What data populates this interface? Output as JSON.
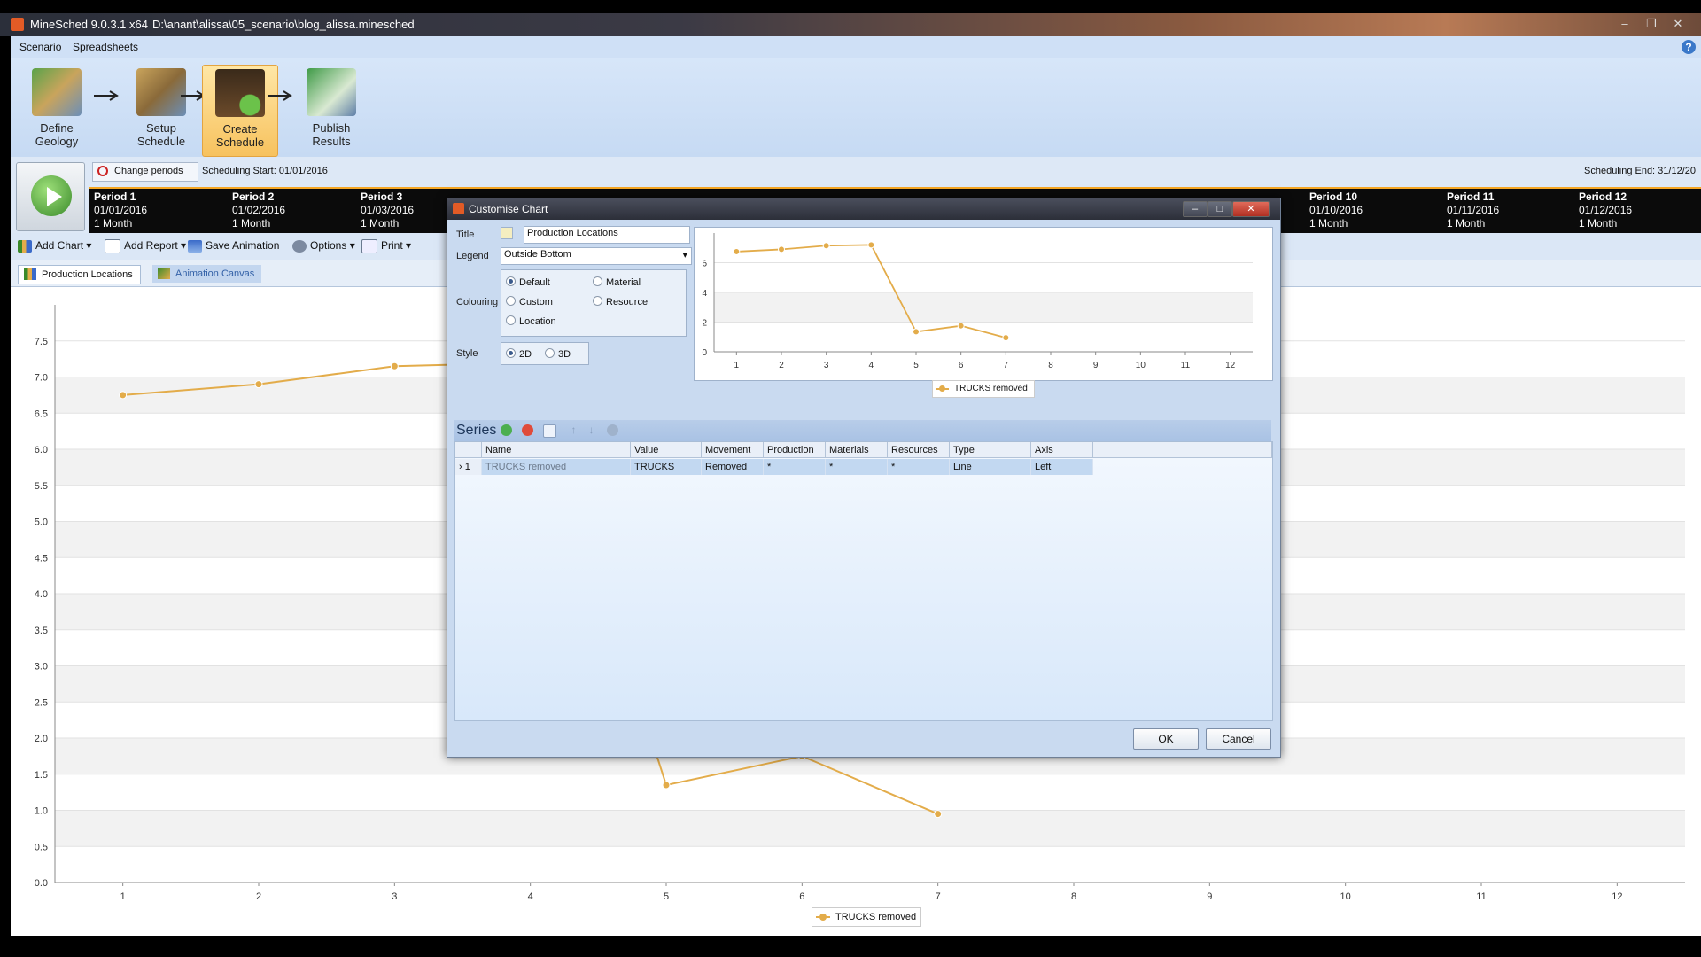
{
  "window": {
    "app_title": "MineSched 9.0.3.1 x64",
    "file_path": "D:\\anant\\alissa\\05_scenario\\blog_alissa.minesched"
  },
  "menu": {
    "items": [
      "Scenario",
      "Spreadsheets"
    ]
  },
  "workflow": {
    "steps": [
      {
        "label": "Define Geology"
      },
      {
        "label": "Setup Schedule"
      },
      {
        "label": "Create Schedule"
      },
      {
        "label": "Publish Results"
      }
    ]
  },
  "periods_bar": {
    "change_periods_label": "Change periods",
    "scheduling_start": "Scheduling Start: 01/01/2016",
    "scheduling_end": "Scheduling End: 31/12/20",
    "periods": [
      {
        "name": "Period 1",
        "date": "01/01/2016",
        "duration": "1 Month"
      },
      {
        "name": "Period 2",
        "date": "01/02/2016",
        "duration": "1 Month"
      },
      {
        "name": "Period 3",
        "date": "01/03/2016",
        "duration": "1 Month"
      },
      {
        "name": "Period 10",
        "date": "01/10/2016",
        "duration": "1 Month"
      },
      {
        "name": "Period 11",
        "date": "01/11/2016",
        "duration": "1 Month"
      },
      {
        "name": "Period 12",
        "date": "01/12/2016",
        "duration": "1 Month"
      }
    ]
  },
  "toolbar": {
    "add_chart": "Add Chart",
    "add_report": "Add Report",
    "save_animation": "Save Animation",
    "options": "Options",
    "print": "Print"
  },
  "tabs": [
    {
      "label": "Production Locations"
    },
    {
      "label": "Animation Canvas"
    }
  ],
  "dialog": {
    "title": "Customise Chart",
    "title_label": "Title",
    "title_value": "Production Locations",
    "legend_label": "Legend",
    "legend_value": "Outside Bottom",
    "colouring_label": "Colouring",
    "colouring_options": [
      "Default",
      "Material",
      "Custom",
      "Resource",
      "Location"
    ],
    "colouring_selected": "Default",
    "style_label": "Style",
    "style_options": [
      "2D",
      "3D"
    ],
    "style_selected": "2D",
    "series_title": "Series",
    "grid_columns": [
      "Name",
      "Value",
      "Movement",
      "Production",
      "Materials",
      "Resources",
      "Type",
      "Axis"
    ],
    "grid_rows": [
      {
        "index": "1",
        "name": "TRUCKS removed",
        "value": "TRUCKS",
        "movement": "Removed",
        "production": "*",
        "materials": "*",
        "resources": "*",
        "type": "Line",
        "axis": "Left"
      }
    ],
    "ok_label": "OK",
    "cancel_label": "Cancel"
  },
  "chart_data": [
    {
      "type": "line",
      "x": [
        1,
        2,
        3,
        4,
        5,
        6,
        7
      ],
      "series": [
        {
          "name": "TRUCKS removed",
          "values": [
            6.75,
            6.9,
            7.15,
            7.2,
            1.35,
            1.75,
            0.95
          ]
        }
      ],
      "x_ticks": [
        1,
        2,
        3,
        4,
        5,
        6,
        7,
        8,
        9,
        10,
        11,
        12
      ],
      "y_ticks": [
        0.0,
        0.5,
        1.0,
        1.5,
        2.0,
        2.5,
        3.0,
        3.5,
        4.0,
        4.5,
        5.0,
        5.5,
        6.0,
        6.5,
        7.0,
        7.5
      ],
      "xlim": [
        0.5,
        12.5
      ],
      "ylim": [
        0,
        8
      ],
      "legend": "bottom",
      "color": "#e3ac4a"
    },
    {
      "type": "line",
      "x": [
        1,
        2,
        3,
        4,
        5,
        6,
        7
      ],
      "series": [
        {
          "name": "TRUCKS removed",
          "values": [
            6.75,
            6.9,
            7.15,
            7.2,
            1.35,
            1.75,
            0.95
          ]
        }
      ],
      "x_ticks": [
        1,
        2,
        3,
        4,
        5,
        6,
        7,
        8,
        9,
        10,
        11,
        12
      ],
      "y_ticks": [
        0,
        2,
        4,
        6
      ],
      "xlim": [
        0.5,
        12.5
      ],
      "ylim": [
        0,
        8
      ],
      "legend": "bottom",
      "color": "#e3ac4a"
    }
  ]
}
